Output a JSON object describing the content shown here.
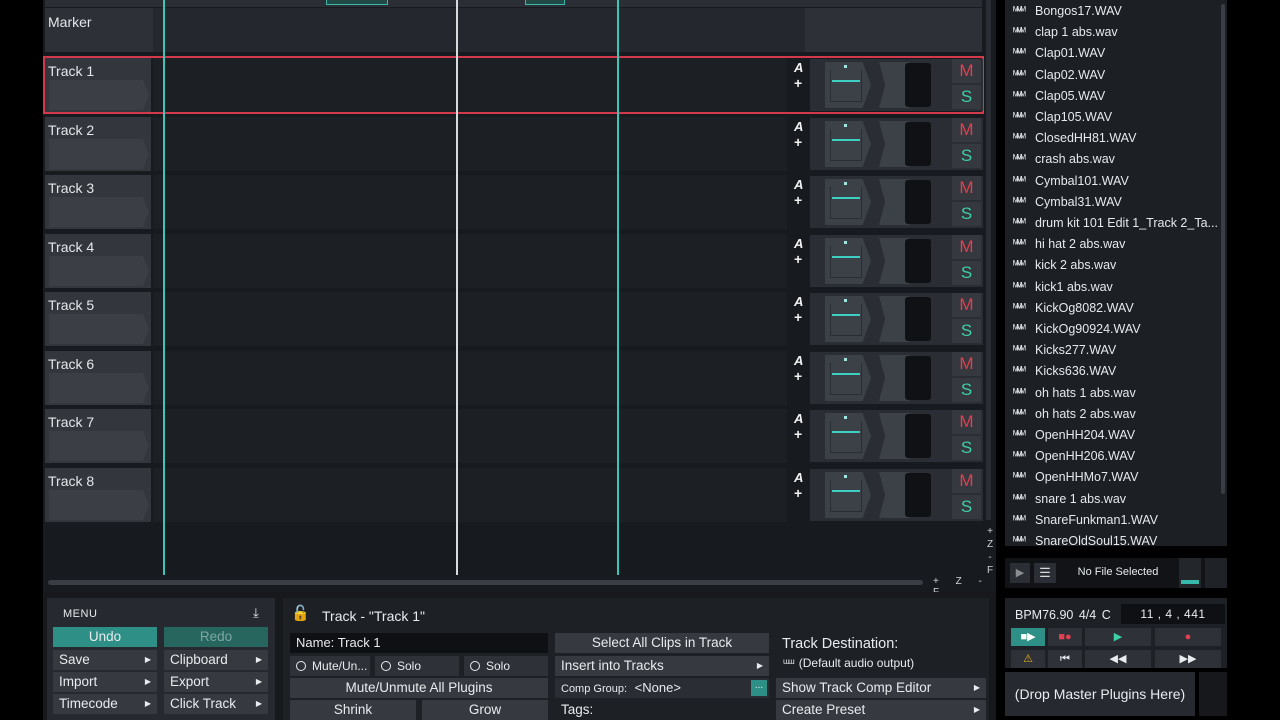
{
  "marker": {
    "label": "Marker"
  },
  "tracks": [
    {
      "name": "Track 1",
      "auto": "A",
      "plus": "+",
      "mute": "M",
      "solo": "S"
    },
    {
      "name": "Track 2",
      "auto": "A",
      "plus": "+",
      "mute": "M",
      "solo": "S"
    },
    {
      "name": "Track 3",
      "auto": "A",
      "plus": "+",
      "mute": "M",
      "solo": "S"
    },
    {
      "name": "Track 4",
      "auto": "A",
      "plus": "+",
      "mute": "M",
      "solo": "S"
    },
    {
      "name": "Track 5",
      "auto": "A",
      "plus": "+",
      "mute": "M",
      "solo": "S"
    },
    {
      "name": "Track 6",
      "auto": "A",
      "plus": "+",
      "mute": "M",
      "solo": "S"
    },
    {
      "name": "Track 7",
      "auto": "A",
      "plus": "+",
      "mute": "M",
      "solo": "S"
    },
    {
      "name": "Track 8",
      "auto": "A",
      "plus": "+",
      "mute": "M",
      "solo": "S"
    }
  ],
  "zoom": {
    "v_plus": "+",
    "v_z": "Z",
    "v_minus": "-",
    "v_f": "F",
    "h_label": "+ Z - F"
  },
  "browser": {
    "files": [
      "Bongos17.WAV",
      "clap 1 abs.wav",
      "Clap01.WAV",
      "Clap02.WAV",
      "Clap05.WAV",
      "Clap105.WAV",
      "ClosedHH81.WAV",
      "crash  abs.wav",
      "Cymbal101.WAV",
      "Cymbal31.WAV",
      "drum kit 101 Edit 1_Track 2_Ta...",
      "hi hat 2 abs.wav",
      "kick 2 abs.wav",
      "kick1 abs.wav",
      "KickOg8082.WAV",
      "KickOg90924.WAV",
      "Kicks277.WAV",
      "Kicks636.WAV",
      "oh hats 1 abs.wav",
      "oh hats 2 abs.wav",
      "OpenHH204.WAV",
      "OpenHH206.WAV",
      "OpenHHMo7.WAV",
      "snare 1 abs.wav",
      "SnareFunkman1.WAV",
      "SnareOldSoul15.WAV"
    ],
    "file_icon": "waveform-icon",
    "preview": {
      "status": "No File Selected"
    }
  },
  "menu": {
    "title": "MENU",
    "undo": "Undo",
    "redo": "Redo",
    "save": "Save",
    "clipboard": "Clipboard",
    "import": "Import",
    "export": "Export",
    "timecode": "Timecode",
    "click_track": "Click Track"
  },
  "track_panel": {
    "title": "Track - \"Track 1\"",
    "name_label": "Name:",
    "name_value": "Track 1",
    "mute_unmute": "Mute/Un...",
    "solo": "Solo",
    "solo_isolate": "Solo Isolate",
    "mute_all_plugins": "Mute/Unmute All Plugins",
    "shrink": "Shrink",
    "grow": "Grow",
    "select_all_clips": "Select All Clips in Track",
    "insert_into_tracks": "Insert into Tracks",
    "comp_group_label": "Comp Group:",
    "comp_group_value": "<None>",
    "comp_more": "...",
    "tags": "Tags:",
    "destination_title": "Track Destination:",
    "destination_value": "(Default audio output)",
    "show_comp_editor": "Show Track Comp Editor",
    "create_preset": "Create Preset"
  },
  "transport": {
    "bpm": "BPM76.90",
    "timesig": "4/4",
    "key": "C",
    "position": "11 , 4 , 441"
  },
  "master": {
    "drop_label": "(Drop Master Plugins Here)"
  },
  "colors": {
    "accent": "#3cc6b8",
    "record": "#e04050",
    "selected_track": "#d03a4a"
  }
}
